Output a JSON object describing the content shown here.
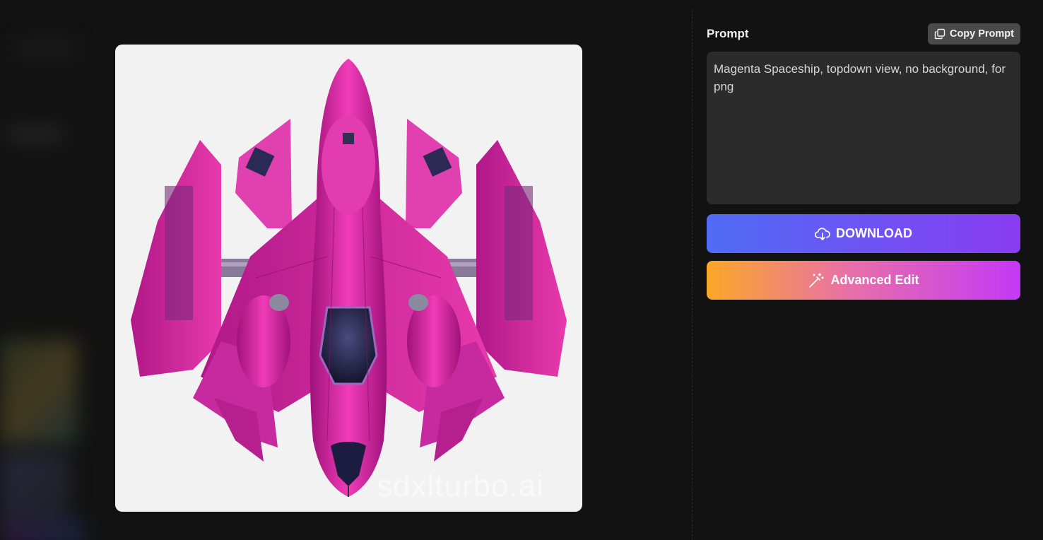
{
  "prompt_panel": {
    "title": "Prompt",
    "copy_button_label": "Copy Prompt",
    "copy_icon": "copy-icon",
    "prompt_text": "Magenta Spaceship, topdown view, no background, for png"
  },
  "actions": {
    "download_label": "DOWNLOAD",
    "download_icon": "cloud-download-icon",
    "advanced_edit_label": "Advanced Edit",
    "advanced_edit_icon": "magic-wand-icon"
  },
  "image": {
    "subject": "magenta-spaceship",
    "watermark": "sdxlturbo.ai"
  },
  "colors": {
    "background": "#121212",
    "download_gradient": [
      "#4f6cf6",
      "#8a3cf0"
    ],
    "advanced_gradient": [
      "#fba826",
      "#e870a8",
      "#c438f6"
    ],
    "ship_primary": "#d6209a"
  }
}
